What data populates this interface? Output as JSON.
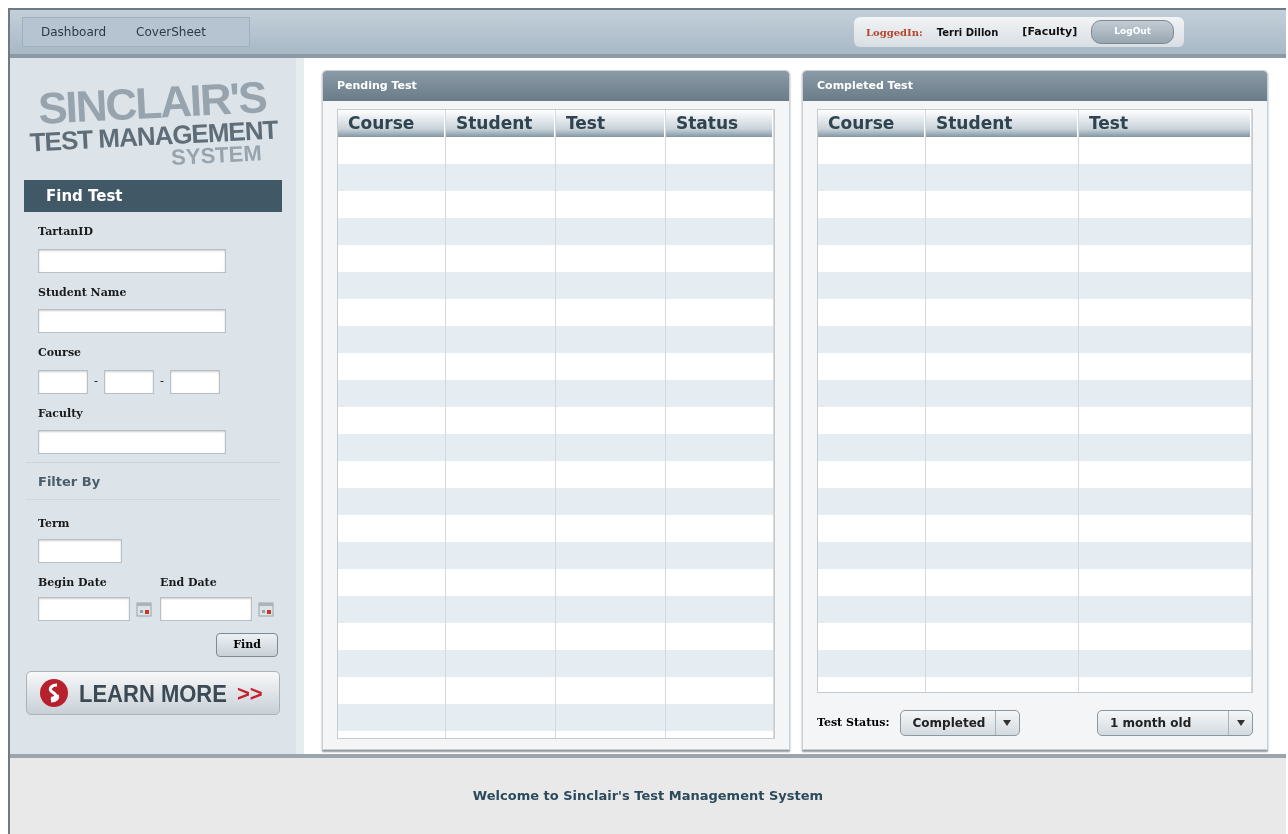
{
  "nav": [
    "Dashboard",
    "CoverSheet"
  ],
  "user": {
    "label": "LoggedIn:",
    "name": "Terri Dillon",
    "role": "[Faculty]",
    "logout": "LogOut"
  },
  "logo": [
    "SINCLAIR'S",
    "TEST MANAGEMENT",
    "SYSTEM"
  ],
  "find": {
    "title": "Find Test",
    "fields": [
      {
        "label": "TartanID",
        "kind": "text"
      },
      {
        "label": "Student Name",
        "kind": "text"
      },
      {
        "label": "Course",
        "kind": "course",
        "separators": [
          "-",
          "-"
        ]
      },
      {
        "label": "Faculty",
        "kind": "text"
      }
    ]
  },
  "filter": {
    "title": "Filter By",
    "term": "Term",
    "dates": [
      "Begin Date",
      "End Date"
    ],
    "button": "Find"
  },
  "learn_more": {
    "text": "LEARN MORE",
    "arrows": ">>"
  },
  "pending": {
    "title": "Pending Test",
    "columns": [
      "Course",
      "Student",
      "Test",
      "Status"
    ]
  },
  "completed": {
    "title": "Completed Test",
    "columns": [
      "Course",
      "Student",
      "Test"
    ],
    "status_label": "Test Status:",
    "status": "Completed",
    "age": "1 month old"
  },
  "footer": "Welcome to Sinclair's Test Management System"
}
